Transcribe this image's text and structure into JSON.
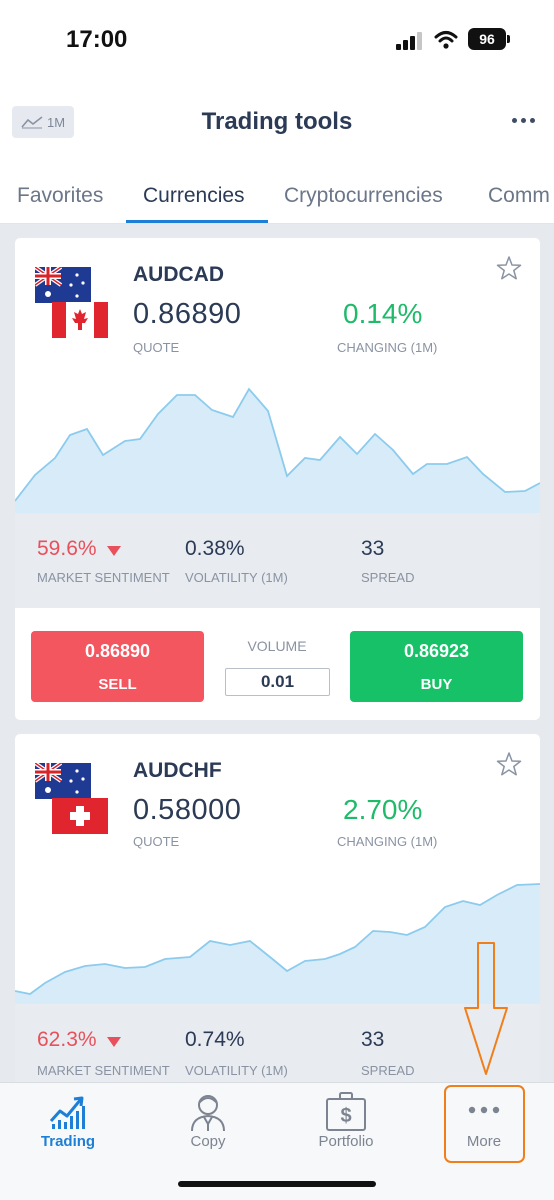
{
  "status_bar": {
    "time": "17:00",
    "battery": "96"
  },
  "header": {
    "period": "1M",
    "title": "Trading tools",
    "more_icon": "ellipsis-icon"
  },
  "tabs": [
    {
      "label": "Favorites",
      "active": false
    },
    {
      "label": "Currencies",
      "active": true
    },
    {
      "label": "Cryptocurrencies",
      "active": false
    },
    {
      "label": "Comm",
      "active": false
    }
  ],
  "labels": {
    "quote": "QUOTE",
    "changing": "CHANGING (1M)",
    "market_sentiment": "MARKET SENTIMENT",
    "volatility": "VOLATILITY (1M)",
    "spread": "SPREAD",
    "volume": "VOLUME",
    "sell": "SELL",
    "buy": "BUY"
  },
  "instruments": [
    {
      "pair": "AUDCAD",
      "quote": "0.86890",
      "changing": "0.14%",
      "market_sentiment": "59.6%",
      "volatility": "0.38%",
      "spread": "33",
      "sell_price": "0.86890",
      "buy_price": "0.86923",
      "volume": "0.01",
      "base_flag": "australia-flag",
      "quote_flag": "canada-flag",
      "favorite": false
    },
    {
      "pair": "AUDCHF",
      "quote": "0.58000",
      "changing": "2.70%",
      "market_sentiment": "62.3%",
      "volatility": "0.74%",
      "spread": "33",
      "base_flag": "australia-flag",
      "quote_flag": "switzerland-flag",
      "favorite": false
    }
  ],
  "bottom_nav": [
    {
      "label": "Trading",
      "icon": "trading-chart-icon",
      "active": true
    },
    {
      "label": "Copy",
      "icon": "copy-trader-icon",
      "active": false
    },
    {
      "label": "Portfolio",
      "icon": "portfolio-briefcase-icon",
      "active": false
    },
    {
      "label": "More",
      "icon": "more-dots-icon",
      "active": false
    }
  ],
  "colors": {
    "accent_blue": "#1d7fd6",
    "sell_red": "#f3565f",
    "buy_green": "#17c167",
    "positive_green": "#1fba6a",
    "sentiment_red": "#e8505b",
    "annotation_orange": "#f07e1a",
    "chart_fill": "#d7ecf8",
    "chart_line": "#8ccbee"
  }
}
